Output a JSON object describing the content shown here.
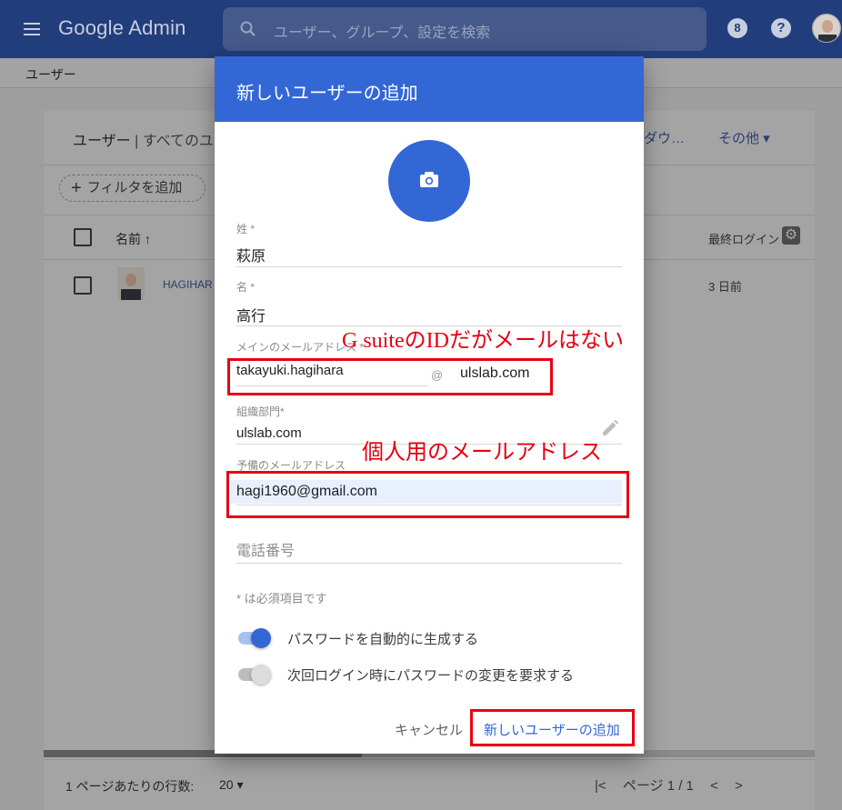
{
  "appbar": {
    "brand": "Google Admin",
    "search_placeholder": "ユーザー、グループ、設定を検索",
    "apps_badge": "8",
    "help_glyph": "?"
  },
  "breadcrumb": "ユーザー",
  "users_card": {
    "title": "ユーザー",
    "title_sub": " | すべてのユ",
    "download_label": "ダウ…",
    "more_label": "その他 ▾",
    "filter_label": "フィルタを追加",
    "columns": {
      "name": "名前 ↑",
      "last_login": "最終ログイン"
    },
    "rows": [
      {
        "name": "HAGIHAR",
        "last_login": "3 日前"
      }
    ],
    "rows_per_page_label": "1 ページあたりの行数:",
    "rows_per_page_value": "20 ▾",
    "pagination": {
      "first": "|<",
      "page": "ページ 1 / 1",
      "prev": "<",
      "next": ">"
    }
  },
  "dialog": {
    "title": "新しいユーザーの追加",
    "last_name": {
      "label": "姓 *",
      "value": "萩原"
    },
    "first_name": {
      "label": "名 *",
      "value": "高行"
    },
    "primary_email": {
      "label": "メインのメールアドレス *",
      "username": "takayuki.hagihara",
      "at": "@",
      "domain": "ulslab.com"
    },
    "org_unit": {
      "label": "組織部門*",
      "value": "ulslab.com"
    },
    "secondary_email": {
      "label": "予備のメールアドレス",
      "value": "hagi1960@gmail.com"
    },
    "phone": {
      "placeholder": "電話番号"
    },
    "required_note": "* は必須項目です",
    "toggles": [
      {
        "label": "パスワードを自動的に生成する",
        "on": true
      },
      {
        "label": "次回ログイン時にパスワードの変更を要求する",
        "on": false
      }
    ],
    "cancel_label": "キャンセル",
    "submit_label": "新しいユーザーの追加"
  },
  "annotations": {
    "gsuite_note": "G suiteのIDだがメールはない",
    "personal_note": "個人用のメールアドレス"
  },
  "colors": {
    "appbar": "#223d7c",
    "dialog_accent": "#3367d6",
    "annotation_red": "#e60012"
  }
}
